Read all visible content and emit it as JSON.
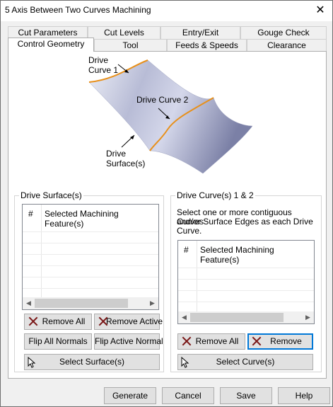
{
  "window": {
    "title": "5 Axis Between Two Curves Machining",
    "close_glyph": "✕"
  },
  "tabs": {
    "row_back": [
      "Cut Parameters",
      "Cut Levels",
      "Entry/Exit",
      "Gouge Check"
    ],
    "row_front": [
      "Control Geometry",
      "Tool",
      "Feeds & Speeds",
      "Clearance"
    ],
    "active": "Control Geometry"
  },
  "diagram": {
    "drive_curve_1": [
      "Drive",
      "Curve 1"
    ],
    "drive_curve_2": "Drive Curve 2",
    "drive_surface": [
      "Drive",
      "Surface(s)"
    ]
  },
  "drive_surface": {
    "label": "Drive Surface(s)",
    "columns": [
      "#",
      "Selected Machining Feature(s)"
    ],
    "remove_all": "Remove All",
    "remove_active": "Remove Active",
    "flip_all": "Flip All Normals",
    "flip_active": "Flip Active Normal",
    "select": "Select Surface(s)"
  },
  "drive_curves": {
    "label": "Drive Curve(s) 1 & 2",
    "help": [
      "Select one or more contiguous Curves",
      "and/or Surface Edges as each Drive",
      "Curve."
    ],
    "columns": [
      "#",
      "Selected Machining Feature(s)"
    ],
    "remove_all": "Remove All",
    "remove": "Remove",
    "select": "Select Curve(s)"
  },
  "footer": {
    "generate": "Generate",
    "cancel": "Cancel",
    "save": "Save",
    "help": "Help"
  },
  "colors": {
    "curve": "#e8901a",
    "surface_light": "#e6e8f4",
    "surface_dark": "#7f84a8",
    "focus": "#0078d7"
  }
}
